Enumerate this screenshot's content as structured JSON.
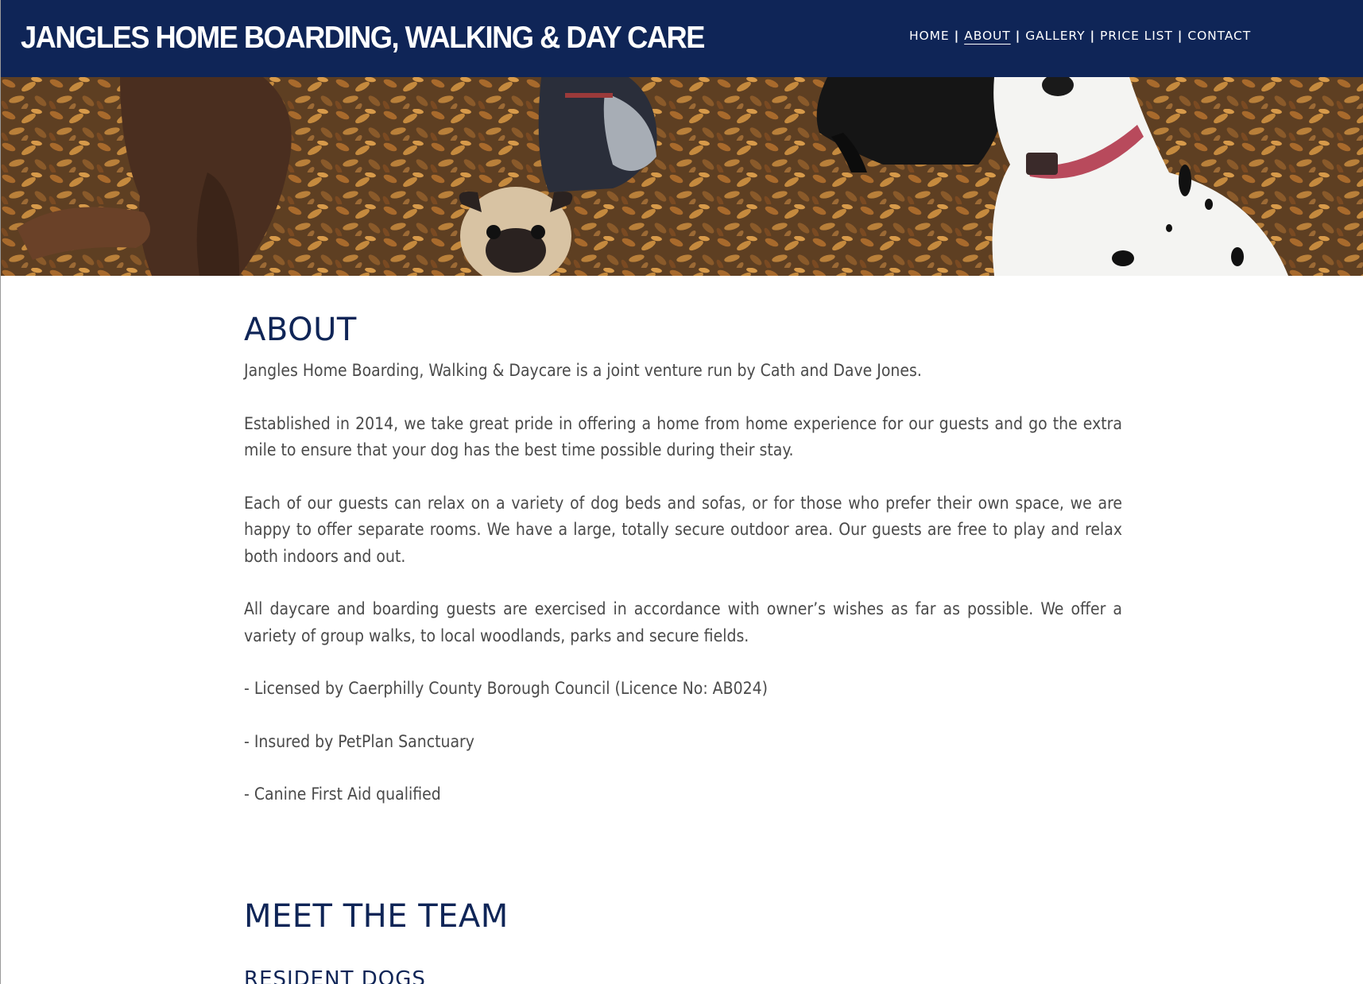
{
  "header": {
    "site_title": "JANGLES HOME BOARDING, WALKING & DAY CARE",
    "nav": [
      {
        "label": "HOME",
        "active": false
      },
      {
        "label": "ABOUT",
        "active": true
      },
      {
        "label": "GALLERY",
        "active": false
      },
      {
        "label": "PRICE LIST",
        "active": false
      },
      {
        "label": "CONTACT",
        "active": false
      }
    ],
    "separator": "|"
  },
  "banner": {
    "icon": "dogs-on-autumn-leaves-photo"
  },
  "about": {
    "title": "ABOUT",
    "paragraphs": [
      "Jangles Home Boarding, Walking & Daycare is a joint venture run by Cath and Dave Jones.",
      "Established in 2014, we take great pride in offering a home from home experience for our guests and go the extra mile to ensure that your dog has the best time possible during their stay.",
      "Each of our guests can relax on a variety of dog beds and sofas, or for those who prefer their own space, we are happy to offer separate rooms. We have a large, totally secure outdoor area. Our guests are free to play and relax both indoors and out.",
      "All daycare and boarding guests are exercised in accordance with owner’s wishes as far as possible. We offer a variety of group walks, to local woodlands, parks and secure fields.",
      "- Licensed by Caerphilly County Borough Council (Licence No: AB024)",
      "- Insured by PetPlan Sanctuary",
      "- Canine First Aid qualified"
    ]
  },
  "team": {
    "title": "MEET THE TEAM",
    "subtitle": "RESIDENT DOGS"
  },
  "colors": {
    "header_bg": "#0f2557",
    "heading": "#0f2557",
    "body_text": "#4a4a4a"
  }
}
